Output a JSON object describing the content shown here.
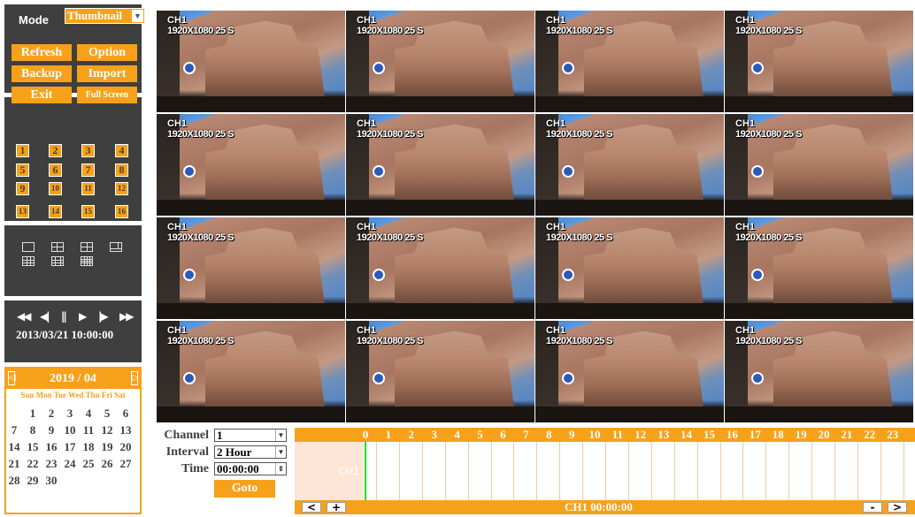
{
  "sidebar": {
    "mode_label": "Mode",
    "mode_value": "Thumbnail",
    "buttons": {
      "refresh": "Refresh",
      "option": "Option",
      "backup": "Backup",
      "import": "Import",
      "exit": "Exit",
      "fullscreen": "Full Screen"
    },
    "channels": [
      "1",
      "2",
      "3",
      "4",
      "5",
      "6",
      "7",
      "8",
      "9",
      "10",
      "11",
      "12",
      "13",
      "14",
      "15",
      "16"
    ],
    "layouts": [
      "layout-1-icon",
      "layout-4-icon",
      "layout-6-icon",
      "layout-8-icon",
      "layout-9-icon",
      "layout-13-icon",
      "layout-16-icon"
    ],
    "playback": {
      "rewind": "◀◀",
      "step_back": "◀|",
      "pause": "||",
      "play": "▶",
      "step_forward": "|▶",
      "fast_forward": "▶▶",
      "datetime": "2013/03/21 10:00:00"
    },
    "calendar": {
      "title": "2019 / 04",
      "dow": "Sun Mon Tue Wed Thu Fri Sat",
      "weeks": [
        [
          "",
          "1",
          "2",
          "3",
          "4",
          "5",
          "6"
        ],
        [
          "7",
          "8",
          "9",
          "10",
          "11",
          "12",
          "13"
        ],
        [
          "14",
          "15",
          "16",
          "17",
          "18",
          "19",
          "20"
        ],
        [
          "21",
          "22",
          "23",
          "24",
          "25",
          "26",
          "27"
        ],
        [
          "28",
          "29",
          "30",
          "",
          "",
          "",
          ""
        ]
      ]
    }
  },
  "grid": {
    "tiles": [
      {
        "ch": "CH1",
        "res": "1920X1080 25 S"
      },
      {
        "ch": "CH1",
        "res": "1920X1080 25 S"
      },
      {
        "ch": "CH1",
        "res": "1920X1080 25 S"
      },
      {
        "ch": "CH1",
        "res": "1920X1080 25 S"
      },
      {
        "ch": "CH1",
        "res": "1920X1080 25 S"
      },
      {
        "ch": "CH1",
        "res": "1920X1080 25 S"
      },
      {
        "ch": "CH1",
        "res": "1920X1080 25 S"
      },
      {
        "ch": "CH1",
        "res": "1920X1080 25 S"
      },
      {
        "ch": "CH1",
        "res": "1920X1080 25 S"
      },
      {
        "ch": "CH1",
        "res": "1920X1080 25 S"
      },
      {
        "ch": "CH1",
        "res": "1920X1080 25 S"
      },
      {
        "ch": "CH1",
        "res": "1920X1080 25 S"
      },
      {
        "ch": "CH1",
        "res": "1920X1080 25 S"
      },
      {
        "ch": "CH1",
        "res": "1920X1080 25 S"
      },
      {
        "ch": "CH1",
        "res": "1920X1080 25 S"
      },
      {
        "ch": "CH1",
        "res": "1920X1080 25 S"
      }
    ]
  },
  "controls": {
    "channel_label": "Channel",
    "channel_value": "1",
    "interval_label": "Interval",
    "interval_value": "2 Hour",
    "time_label": "Time",
    "time_value": "00:00:00",
    "goto": "Goto"
  },
  "timeline": {
    "hours": [
      "0",
      "1",
      "2",
      "3",
      "4",
      "5",
      "6",
      "7",
      "8",
      "9",
      "10",
      "11",
      "12",
      "13",
      "14",
      "15",
      "16",
      "17",
      "18",
      "19",
      "20",
      "21",
      "22",
      "23"
    ],
    "channel": "CH1",
    "prev": "<",
    "zoom_in": "+",
    "zoom_out": "-",
    "next": ">",
    "status": "CH1 00:00:00"
  },
  "colors": {
    "accent": "#f7a11a",
    "panel": "#3f3f3f",
    "cursor": "#19e019"
  }
}
